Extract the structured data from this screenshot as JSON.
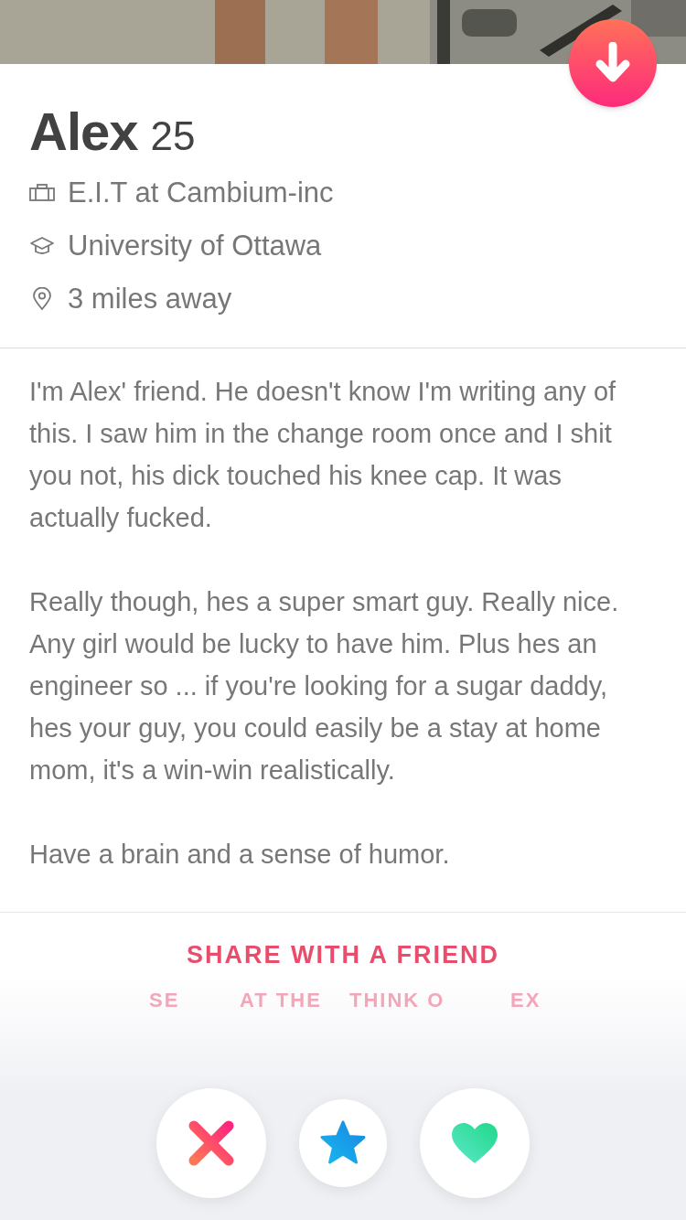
{
  "profile": {
    "name": "Alex",
    "age": "25",
    "details": [
      {
        "kind": "job",
        "text": "E.I.T at Cambium-inc"
      },
      {
        "kind": "school",
        "text": "University of Ottawa"
      },
      {
        "kind": "distance",
        "text": "3 miles away"
      }
    ],
    "bio": [
      "I'm Alex' friend. He doesn't know I'm writing any of this. I saw him in the change room once and I shit you not, his dick touched his knee cap. It was actually fucked.",
      "Really though, hes a super smart guy. Really nice. Any girl would be lucky to have him. Plus hes an engineer so ... if you're looking for a sugar daddy, hes your guy, you could easily be a stay at home mom, it's a win-win realistically.",
      "Have a brain and a sense of humor."
    ]
  },
  "share": {
    "title": "SHARE WITH A FRIEND",
    "subtitle_fragments": [
      "SE",
      "AT THE",
      "THINK O",
      "EX"
    ]
  },
  "actions": [
    {
      "kind": "nope"
    },
    {
      "kind": "super_like"
    },
    {
      "kind": "like"
    }
  ]
}
